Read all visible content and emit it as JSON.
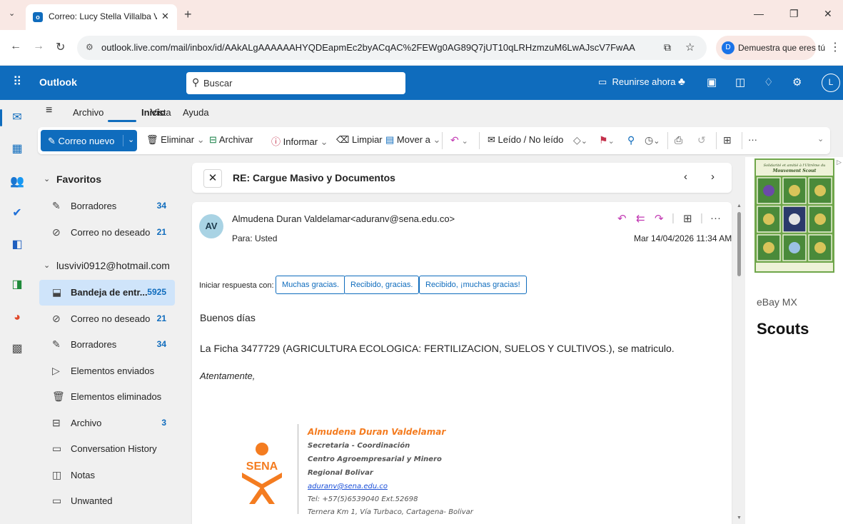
{
  "browser": {
    "tab_title": "Correo: Lucy Stella Villalba Villa",
    "url": "outlook.live.com/mail/inbox/id/AAkALgAAAAAAHYQDEapmEc2byACqAC%2FEWg0AG89Q7jUT10qLRHzmzuM6LwAJscV7FwAA",
    "profile_label": "Demuestra que eres tú",
    "profile_initial": "D"
  },
  "header": {
    "brand": "Outlook",
    "search_placeholder": "Buscar",
    "meet_label": "Reunirse ahora",
    "user_initial": "L"
  },
  "ribbon": {
    "tabs": [
      "Archivo",
      "Inicio",
      "Vista",
      "Ayuda"
    ],
    "new_mail": "Correo nuevo",
    "commands": {
      "delete": "Eliminar",
      "archive": "Archivar",
      "report": "Informar",
      "sweep": "Limpiar",
      "move": "Mover a",
      "read_unread": "Leído / No leído",
      "more": "···"
    }
  },
  "folders": {
    "favorites_title": "Favoritos",
    "favorites": [
      {
        "label": "Borradores",
        "count": "34",
        "icon": "drafts-icon"
      },
      {
        "label": "Correo no deseado",
        "count": "21",
        "icon": "junk-icon"
      }
    ],
    "account": "lusvivi0912@hotmail.com",
    "account_items": [
      {
        "label": "Bandeja de entr...",
        "count": "5925",
        "icon": "inbox-icon",
        "selected": true
      },
      {
        "label": "Correo no deseado",
        "count": "21",
        "icon": "junk-icon"
      },
      {
        "label": "Borradores",
        "count": "34",
        "icon": "drafts-icon"
      },
      {
        "label": "Elementos enviados",
        "count": "",
        "icon": "sent-icon"
      },
      {
        "label": "Elementos eliminados",
        "count": "",
        "icon": "trash-icon"
      },
      {
        "label": "Archivo",
        "count": "3",
        "icon": "archive-icon"
      },
      {
        "label": "Conversation History",
        "count": "",
        "icon": "folder-icon"
      },
      {
        "label": "Notas",
        "count": "",
        "icon": "notes-icon"
      },
      {
        "label": "Unwanted",
        "count": "",
        "icon": "folder-icon"
      }
    ]
  },
  "message": {
    "subject": "RE: Cargue Masivo y Documentos",
    "sender_initials": "AV",
    "sender": "Almudena Duran Valdelamar<aduranv@sena.edu.co>",
    "to": "Para:  Usted",
    "date": "Mar 14/04/2026 11:34 AM",
    "quick_reply_label": "Iniciar respuesta con:",
    "quick_replies": [
      "Muchas gracias.",
      "Recibido, gracias.",
      "Recibido, ¡muchas gracias!"
    ],
    "greeting": "Buenos días",
    "body": "La Ficha 3477729 (AGRICULTURA ECOLOGICA: FERTILIZACION, SUELOS Y CULTIVOS.), se matriculo.",
    "closing": "Atentamente,",
    "signature": {
      "name": "Almudena Duran Valdelamar",
      "role": "Secretaria - Coordinación",
      "center": "Centro Agroempresarial y Minero",
      "region": "Regional Bolivar",
      "email": "aduranv@sena.edu.co",
      "phone": "Tel: +57(5)6539040 Ext.52698",
      "address": "Ternera Km 1, Vía Turbaco, Cartagena- Bolivar",
      "logo_text": "SENA"
    }
  },
  "ad": {
    "source": "eBay MX",
    "title": "Scouts"
  },
  "colors": {
    "brand": "#0f6cbd",
    "accent_action": "#c239b3",
    "sena_orange": "#f47c20"
  }
}
